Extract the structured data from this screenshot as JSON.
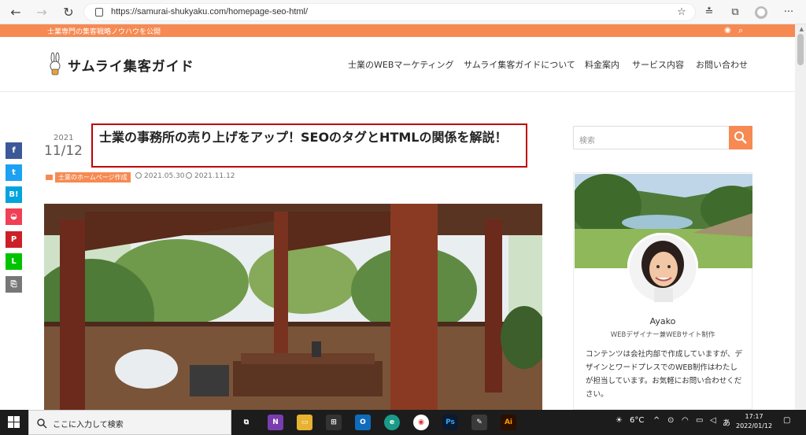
{
  "browser": {
    "url": "https://samurai-shukyaku.com/homepage-seo-html/"
  },
  "site": {
    "tagline": "士業専門の集客戦略ノウハウを公開",
    "logo_text": "サムライ集客ガイド",
    "nav": [
      {
        "label": "士業のWEBマーケティング"
      },
      {
        "label": "サムライ集客ガイドについて"
      },
      {
        "label": "料金案内"
      },
      {
        "label": "サービス内容"
      },
      {
        "label": "お問い合わせ"
      }
    ]
  },
  "share": [
    {
      "label": "f",
      "color": "#3b5998",
      "icon": "facebook-icon"
    },
    {
      "label": "t",
      "color": "#1da1f2",
      "icon": "twitter-icon"
    },
    {
      "label": "B!",
      "color": "#00a4de",
      "icon": "hatena-icon"
    },
    {
      "label": "◒",
      "color": "#ef4056",
      "icon": "pocket-icon"
    },
    {
      "label": "P",
      "color": "#cb2027",
      "icon": "pinterest-icon"
    },
    {
      "label": "L",
      "color": "#00c300",
      "icon": "line-icon"
    },
    {
      "label": "⎘",
      "color": "#777777",
      "icon": "copy-icon"
    }
  ],
  "article": {
    "year": "2021",
    "month_day": "11/12",
    "title": "士業の事務所の売り上げをアップ！SEOのタグとHTMLの関係を解説！",
    "category": "士業のホームページ作成",
    "published": "2021.05.30",
    "updated": "2021.11.12"
  },
  "sidebar": {
    "search_placeholder": "検索",
    "profile_name": "Ayako",
    "profile_role": "WEBデザイナー兼WEBサイト制作",
    "profile_bio": "コンテンツは会社内部で作成していますが、デザインとワードプレスでのWEB制作はわたしが担当しています。お気軽にお問い合わせください。"
  },
  "taskbar": {
    "search_text": "ここに入力して検索",
    "weather": "6°C",
    "ime": "あ",
    "time": "17:17",
    "date": "2022/01/12"
  }
}
